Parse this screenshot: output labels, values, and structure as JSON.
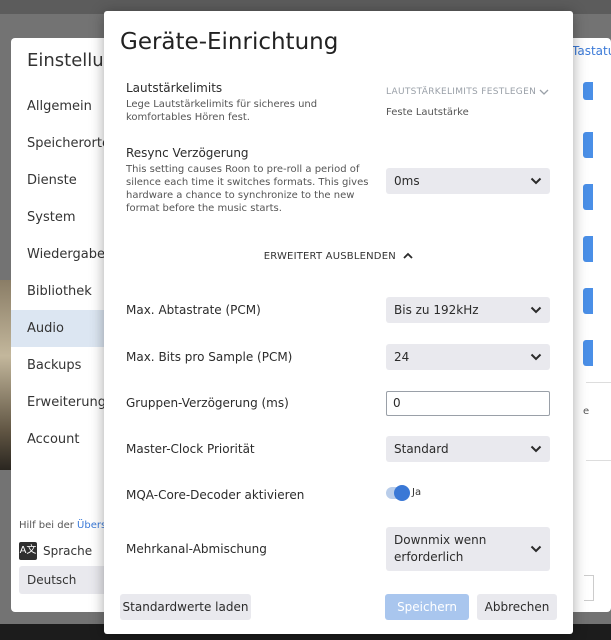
{
  "background": {
    "settings": {
      "title": "Einstellungen",
      "nav": [
        "Allgemein",
        "Speicherorte",
        "Dienste",
        "System",
        "Wiedergabeabschnitte",
        "Bibliothek",
        "Audio",
        "Backups",
        "Erweiterungen",
        "Account"
      ],
      "active_nav": "Audio",
      "help_prefix": "Hilf bei der ",
      "help_link": "Übersetzung",
      "language_label": "Sprache",
      "language_value": "Deutsch",
      "right_link": "Tastatur"
    }
  },
  "dialog": {
    "title": "Geräte-Einrichtung",
    "volume_limits": {
      "label": "Lautstärkelimits",
      "description": "Lege Lautstärkelimits für sicheres und komfortables Hören fest.",
      "action": "LAUTSTÄRKELIMITS FESTLEGEN",
      "value": "Feste Lautstärke"
    },
    "resync": {
      "label": "Resync Verzögerung",
      "description": "This setting causes Roon to pre-roll a period of silence each time it switches formats. This gives hardware a chance to synchronize to the new format before the music starts.",
      "value": "0ms"
    },
    "collapse_label": "ERWEITERT AUSBLENDEN",
    "max_samplerate": {
      "label": "Max. Abtastrate (PCM)",
      "value": "Bis zu 192kHz"
    },
    "max_bits": {
      "label": "Max. Bits pro Sample (PCM)",
      "value": "24"
    },
    "group_delay": {
      "label": "Gruppen-Verzögerung (ms)",
      "value": "0"
    },
    "master_clock": {
      "label": "Master-Clock Priorität",
      "value": "Standard"
    },
    "mqa_core": {
      "label": "MQA-Core-Decoder aktivieren",
      "state": "Ja"
    },
    "multichannel": {
      "label": "Mehrkanal-Abmischung",
      "value": "Downmix wenn erforderlich"
    },
    "buttons": {
      "reset": "Standardwerte laden",
      "save": "Speichern",
      "cancel": "Abbrechen"
    }
  },
  "colors": {
    "accent": "#3a78d6",
    "select_bg": "#e9e9ee",
    "save_disabled": "#a9c6ee"
  }
}
